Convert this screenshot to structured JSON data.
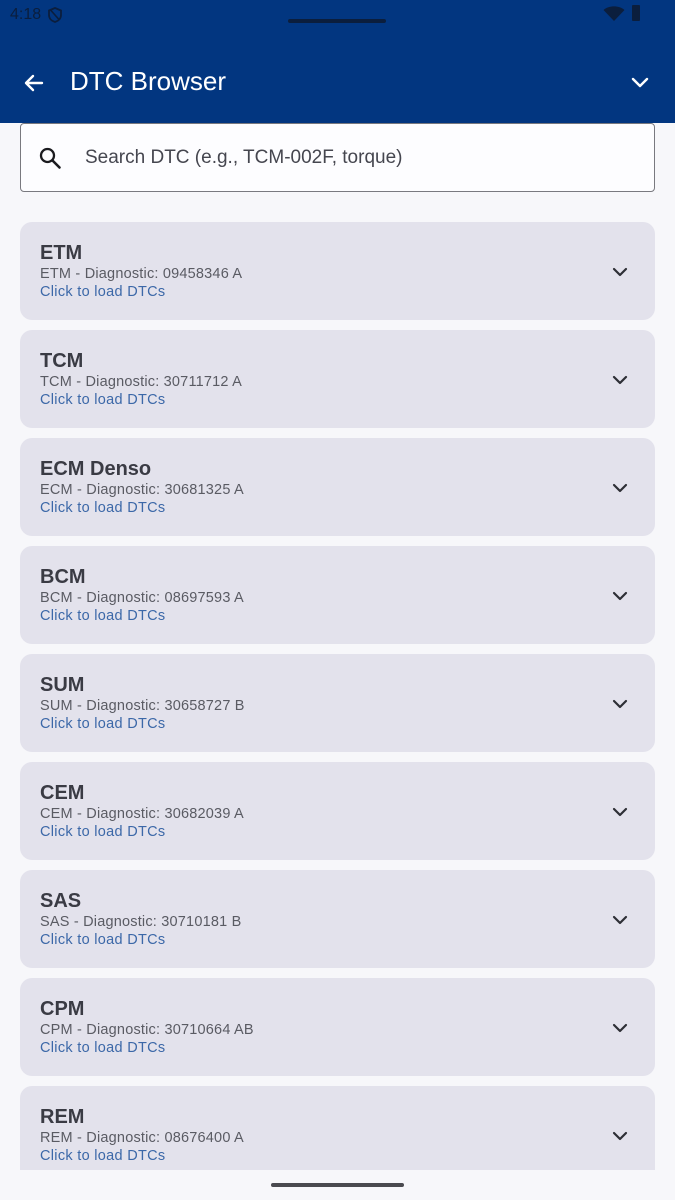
{
  "status_bar": {
    "time": "4:18",
    "icons": [
      "shield-icon",
      "wifi-icon",
      "battery-icon"
    ]
  },
  "app_bar": {
    "title": "DTC Browser",
    "back_icon": "arrow-left-icon",
    "menu_icon": "chevron-down-icon"
  },
  "search": {
    "placeholder": "Search DTC (e.g., TCM-002F, torque)",
    "value": "",
    "icon": "search-icon"
  },
  "modules": [
    {
      "name": "ETM",
      "diagnostic": "ETM - Diagnostic: 09458346  A",
      "action": "Click to load DTCs"
    },
    {
      "name": "TCM",
      "diagnostic": "TCM - Diagnostic: 30711712  A",
      "action": "Click to load DTCs"
    },
    {
      "name": "ECM Denso",
      "diagnostic": "ECM - Diagnostic: 30681325  A",
      "action": "Click to load DTCs"
    },
    {
      "name": "BCM",
      "diagnostic": "BCM - Diagnostic: 08697593  A",
      "action": "Click to load DTCs"
    },
    {
      "name": "SUM",
      "diagnostic": "SUM - Diagnostic: 30658727  B",
      "action": "Click to load DTCs"
    },
    {
      "name": "CEM",
      "diagnostic": "CEM - Diagnostic: 30682039  A",
      "action": "Click to load DTCs"
    },
    {
      "name": "SAS",
      "diagnostic": "SAS - Diagnostic: 30710181  B",
      "action": "Click to load DTCs"
    },
    {
      "name": "CPM",
      "diagnostic": "CPM - Diagnostic: 30710664 AB",
      "action": "Click to load DTCs"
    },
    {
      "name": "REM",
      "diagnostic": "REM - Diagnostic: 08676400  A",
      "action": "Click to load DTCs"
    }
  ],
  "colors": {
    "app_bar": "#023680",
    "card": "#e3e2ec",
    "link": "#3c68a8",
    "background": "#f7f7fa"
  }
}
